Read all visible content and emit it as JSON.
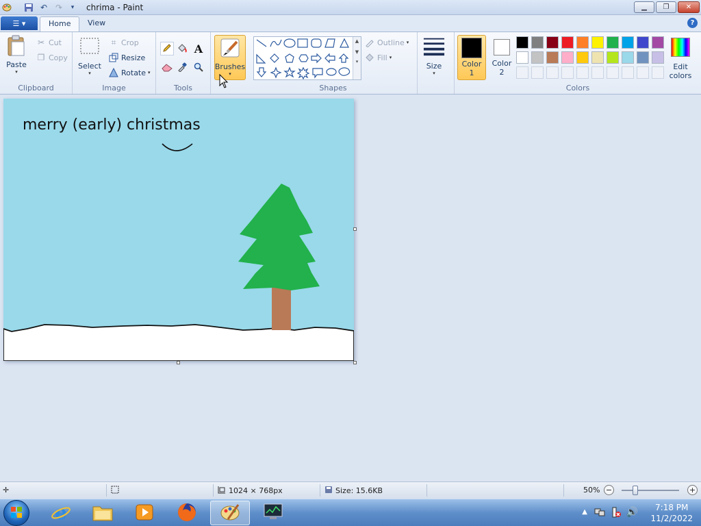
{
  "window": {
    "title": "chrima - Paint"
  },
  "tabs": {
    "home": "Home",
    "view": "View"
  },
  "clipboard": {
    "paste": "Paste",
    "cut": "Cut",
    "copy": "Copy",
    "group_label": "Clipboard"
  },
  "image": {
    "select": "Select",
    "crop": "Crop",
    "resize": "Resize",
    "rotate": "Rotate",
    "group_label": "Image"
  },
  "tools": {
    "group_label": "Tools"
  },
  "brushes": {
    "label": "Brushes"
  },
  "shapes": {
    "outline": "Outline",
    "fill": "Fill",
    "group_label": "Shapes"
  },
  "size": {
    "label": "Size"
  },
  "colors": {
    "color1_line1": "Color",
    "color1_line2": "1",
    "color2_line1": "Color",
    "color2_line2": "2",
    "edit_line1": "Edit",
    "edit_line2": "colors",
    "group_label": "Colors",
    "color1_value": "#000000",
    "color2_value": "#ffffff",
    "palette": [
      [
        "#000000",
        "#7f7f7f",
        "#880015",
        "#ed1c24",
        "#ff7f27",
        "#fff200",
        "#22b14c",
        "#00a2e8",
        "#3f48cc",
        "#a349a4"
      ],
      [
        "#ffffff",
        "#c3c3c3",
        "#b97a57",
        "#ffaec9",
        "#ffc90e",
        "#efe4b0",
        "#b5e61d",
        "#99d9ea",
        "#7092be",
        "#c8bfe7"
      ],
      [
        "",
        "",
        "",
        "",
        "",
        "",
        "",
        "",
        "",
        ""
      ]
    ]
  },
  "canvas": {
    "text": "merry (early) christmas",
    "sky_color": "#99d9ea",
    "tree_color": "#22b14c",
    "trunk_color": "#b97a57",
    "snow_color": "#ffffff"
  },
  "status": {
    "dimensions": "1024 × 768px",
    "size": "Size: 15.6KB",
    "zoom": "50%"
  },
  "taskbar": {
    "time": "7:18 PM",
    "date": "11/2/2022"
  }
}
